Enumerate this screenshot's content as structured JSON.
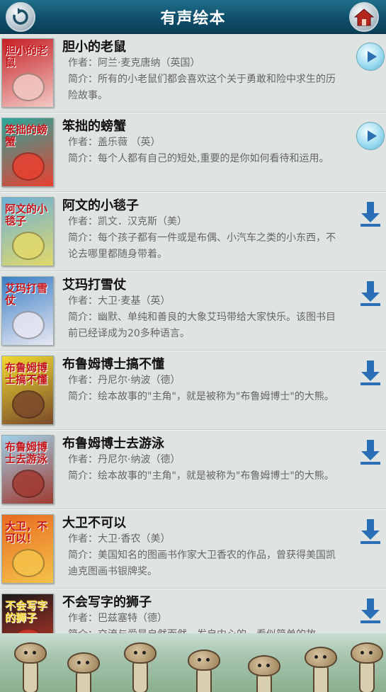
{
  "header": {
    "title": "有声绘本",
    "back_icon": "refresh-back-icon",
    "home_icon": "home-icon"
  },
  "books": [
    {
      "title": "胆小的老鼠",
      "author": "作者：阿兰·麦克唐纳（英国）",
      "desc": "简介：所有的小老鼠们都会喜欢这个关于勇敢和险中求生的历险故事。",
      "cover_text": "胆小的老鼠",
      "cover_colors": [
        "#c62025",
        "#f2c9c4"
      ],
      "action": "play"
    },
    {
      "title": "笨拙的螃蟹",
      "author": "作者：盖乐薇 （英）",
      "desc": "简介：每个人都有自己的短处,重要的是你如何看待和运用。",
      "cover_text": "笨拙的螃蟹",
      "cover_colors": [
        "#2aa69a",
        "#e84030"
      ],
      "action": "play"
    },
    {
      "title": "阿文的小毯子",
      "author": "作者：凯文．汉克斯（美）",
      "desc": "简介：每个孩子都有一件或是布偶、小汽车之类的小东西，不论去哪里都随身带着。",
      "cover_text": "阿文的小毯子",
      "cover_colors": [
        "#6ab0d8",
        "#e2d96a"
      ],
      "action": "download"
    },
    {
      "title": "艾玛打雪仗",
      "author": "作者：大卫·麦基（英）",
      "desc": "简介：幽默、单纯和善良的大象艾玛带给大家快乐。该图书目前已经译成为20多种语言。",
      "cover_text": "艾玛打雪仗",
      "cover_colors": [
        "#3b7fc6",
        "#e8e8f2"
      ],
      "action": "download"
    },
    {
      "title": "布鲁姆博士搞不懂",
      "author": "作者：丹尼尔·纳波（德）",
      "desc": "简介：绘本故事的\"主角\"，就是被称为\"布鲁姆博士\"的大熊。",
      "cover_text": "布鲁姆博士搞不懂",
      "cover_colors": [
        "#f0d830",
        "#7a4a2a"
      ],
      "action": "download"
    },
    {
      "title": "布鲁姆博士去游泳",
      "author": "作者：丹尼尔·纳波（德）",
      "desc": "简介：绘本故事的\"主角\"，就是被称为\"布鲁姆博士\"的大熊。",
      "cover_text": "布鲁姆博士去游泳",
      "cover_colors": [
        "#9fd0e8",
        "#a03a30"
      ],
      "action": "download"
    },
    {
      "title": "大卫不可以",
      "author": "作者：大卫·香农（美）",
      "desc": "简介：美国知名的图画书作家大卫香农的作品，曾获得美国凯迪克图画书银牌奖。",
      "cover_text": "大卫，不可以！",
      "cover_colors": [
        "#e86a20",
        "#f5c34a"
      ],
      "action": "download"
    },
    {
      "title": "不会写字的狮子",
      "author": "作者：巴兹塞特（德）",
      "desc": "简介：交流与爱是自然而然、发自内心的，看似简单的故",
      "cover_text": "不会写字的狮子",
      "cover_colors": [
        "#1a1a1a",
        "#d23a2a"
      ],
      "action": "download"
    }
  ],
  "banner": {
    "icon": "mushroom-banner-image"
  }
}
